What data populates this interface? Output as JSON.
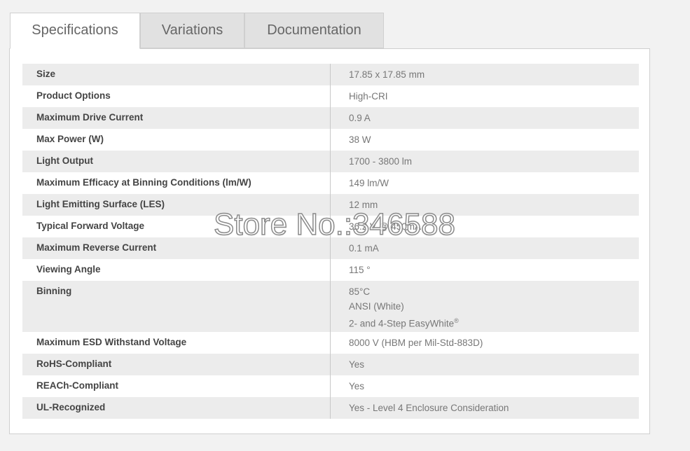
{
  "tabs": [
    {
      "label": "Specifications",
      "active": true
    },
    {
      "label": "Variations",
      "active": false
    },
    {
      "label": "Documentation",
      "active": false
    }
  ],
  "specs": [
    {
      "label": "Size",
      "value": "17.85 x 17.85 mm"
    },
    {
      "label": "Product Options",
      "value": "High-CRI"
    },
    {
      "label": "Maximum Drive Current",
      "value": "0.9 A"
    },
    {
      "label": "Max Power (W)",
      "value": "38 W"
    },
    {
      "label": "Light Output",
      "value": "1700 - 3800 lm"
    },
    {
      "label": "Maximum Efficacy at Binning Conditions (lm/W)",
      "value": "149 lm/W"
    },
    {
      "label": "Light Emitting Surface (LES)",
      "value": "12 mm"
    },
    {
      "label": "Typical Forward Voltage",
      "value": "36.2 V @ 450mA"
    },
    {
      "label": "Maximum Reverse Current",
      "value": "0.1 mA"
    },
    {
      "label": "Viewing Angle",
      "value": "115 °"
    },
    {
      "label": "Binning",
      "lines": [
        "85°C",
        "ANSI (White)",
        "2- and 4-Step EasyWhite"
      ],
      "superscript": "®"
    },
    {
      "label": "Maximum ESD Withstand Voltage",
      "value": "8000 V (HBM per Mil-Std-883D)"
    },
    {
      "label": "RoHS-Compliant",
      "value": "Yes"
    },
    {
      "label": "REACh-Compliant",
      "value": "Yes"
    },
    {
      "label": "UL-Recognized",
      "value": "Yes - Level 4 Enclosure Consideration"
    }
  ],
  "watermark": "Store No.:346588"
}
